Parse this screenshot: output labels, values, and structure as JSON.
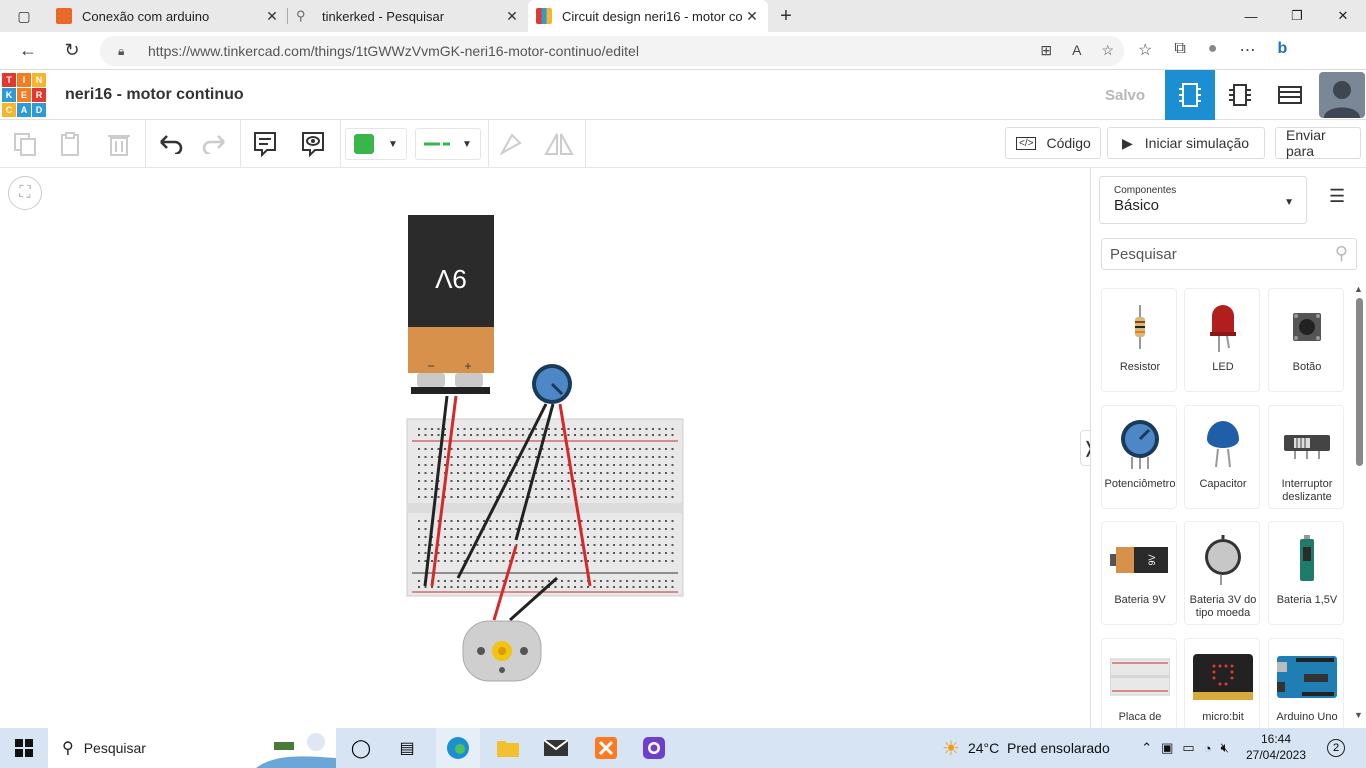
{
  "browser": {
    "tabs": [
      {
        "label": "Conexão com arduino",
        "favicon": "tinkercad-orange-icon"
      },
      {
        "label": "tinkerked - Pesquisar",
        "favicon": "search-icon"
      },
      {
        "label": "Circuit design neri16 - motor co",
        "favicon": "tinkercad-grid-icon"
      }
    ],
    "url": "https://www.tinkercad.com/things/1tGWWzVvmGK-neri16-motor-continuo/editel"
  },
  "app": {
    "logo_letters": [
      "T",
      "I",
      "N",
      "K",
      "E",
      "R",
      "C",
      "A",
      "D"
    ],
    "design_title": "neri16 - motor continuo",
    "saved_label": "Salvo"
  },
  "toolbar": {
    "code_label": "Código",
    "simulate_label": "Iniciar simulação",
    "send_label": "Enviar para",
    "fill_color": "#3ab54a",
    "wire_color": "#3ab54a"
  },
  "canvas": {
    "battery_label": "9V",
    "battery_minus": "−",
    "battery_plus": "+"
  },
  "panel": {
    "components_small": "Componentes",
    "components_value": "Básico",
    "search_placeholder": "Pesquisar",
    "items": [
      {
        "label": "Resistor"
      },
      {
        "label": "LED"
      },
      {
        "label": "Botão"
      },
      {
        "label": "Potenciômetro"
      },
      {
        "label": "Capacitor"
      },
      {
        "label": "Interruptor deslizante"
      },
      {
        "label": "Bateria 9V"
      },
      {
        "label": "Bateria 3V do tipo moeda"
      },
      {
        "label": "Bateria 1,5V"
      },
      {
        "label": "Placa de"
      },
      {
        "label": "micro:bit"
      },
      {
        "label": "Arduino Uno"
      }
    ]
  },
  "taskbar": {
    "search_label": "Pesquisar",
    "weather": "24°C  Pred ensolarado",
    "time": "16:44",
    "date": "27/04/2023",
    "notif_count": "2"
  }
}
